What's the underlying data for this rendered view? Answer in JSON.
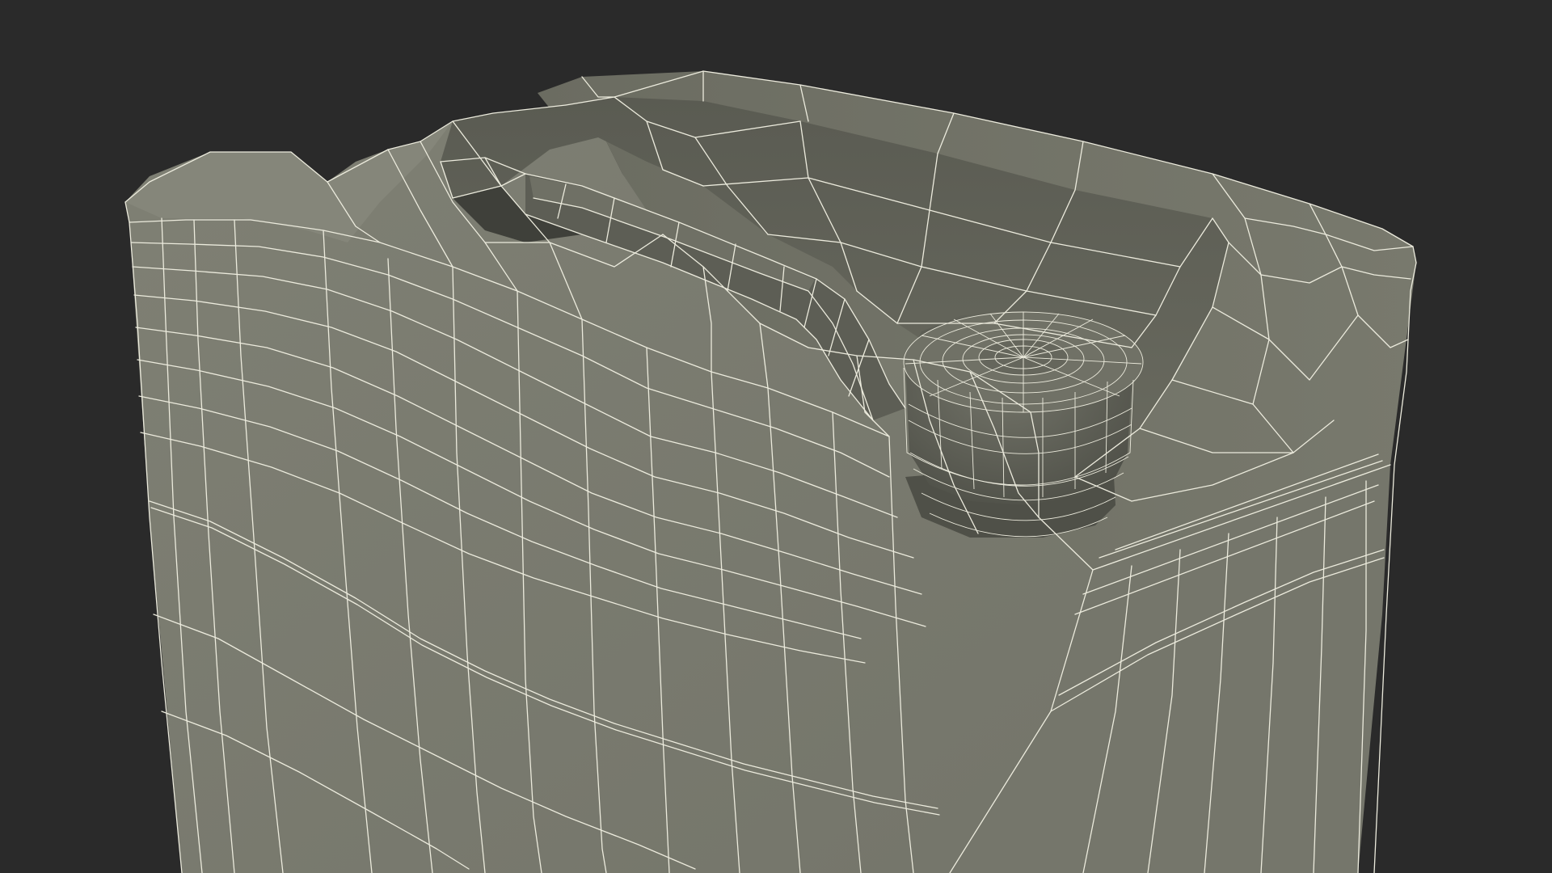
{
  "scene": {
    "subject": "jerrycan-wireframe-render",
    "colors": {
      "background": "#2a2a2a",
      "surface_light": "#7b7c6f",
      "surface_mid": "#6c6d61",
      "surface_dark": "#4e4f46",
      "surface_shadow": "#3d3e37",
      "wireframe": "#ecebdd"
    }
  }
}
